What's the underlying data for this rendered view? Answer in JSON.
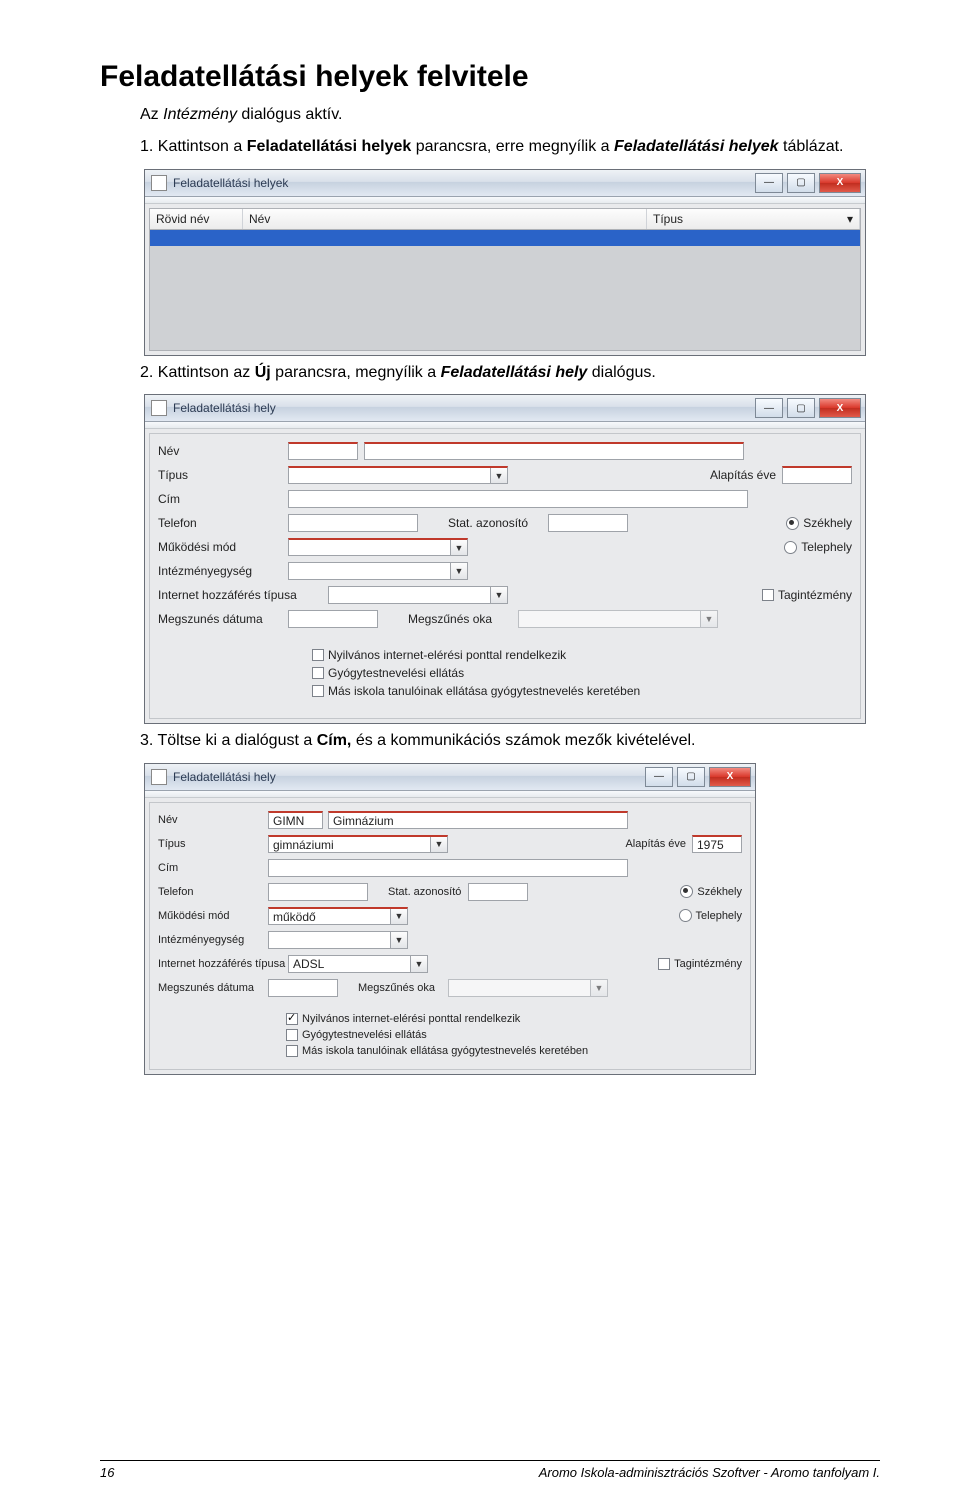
{
  "page_title": "Feladatellátási helyek felvitele",
  "intro_line_pre": "Az ",
  "intro_line_em": "Intézmény",
  "intro_line_post": " dialógus aktív.",
  "step1_pre": "1. Kattintson a ",
  "step1_b1": "Feladatellátási helyek",
  "step1_mid": " parancsra, erre megnyílik a ",
  "step1_bi": "Feladatellátási helyek",
  "step1_post": " táblázat.",
  "step2_pre": "2. Kattintson az ",
  "step2_b1": "Új",
  "step2_mid": " parancsra, megnyílik a ",
  "step2_bi": "Feladatellátási hely",
  "step2_post": " dialógus.",
  "step3_pre": "3. Töltse ki a dialógust a ",
  "step3_b1": "Cím,",
  "step3_mid": " és a kommunikációs számok mezők kivételével.",
  "win1": {
    "title": "Feladatellátási helyek",
    "cols": {
      "rovid": "Rövid név",
      "nev": "Név",
      "tipus": "Típus"
    }
  },
  "labels": {
    "nev": "Név",
    "tipus": "Típus",
    "alapitas": "Alapítás éve",
    "cim": "Cím",
    "telefon": "Telefon",
    "stat": "Stat. azonosító",
    "szekhely": "Székhely",
    "mukodesi": "Működési mód",
    "telephely": "Telephely",
    "intezmenyegyseg": "Intézményegység",
    "internet": "Internet hozzáférés típusa",
    "tagintezmeny": "Tagintézmény",
    "megszunes_datum": "Megszunés dátuma",
    "megszunes_oka": "Megszűnés oka",
    "cb1": "Nyilvános internet-elérési ponttal rendelkezik",
    "cb2": "Gyógytestnevelési ellátás",
    "cb3": "Más iskola tanulóinak ellátása gyógytestnevelés keretében"
  },
  "win2": {
    "title": "Feladatellátási hely"
  },
  "win3": {
    "title": "Feladatellátási hely",
    "values": {
      "nev_code": "GIMN",
      "nev_full": "Gimnázium",
      "tipus": "gimnáziumi",
      "alapitas": "1975",
      "mukodesi": "működő",
      "internet": "ADSL"
    }
  },
  "footer": {
    "page_no": "16",
    "text": "Aromo Iskola-adminisztrációs Szoftver - Aromo tanfolyam I."
  }
}
